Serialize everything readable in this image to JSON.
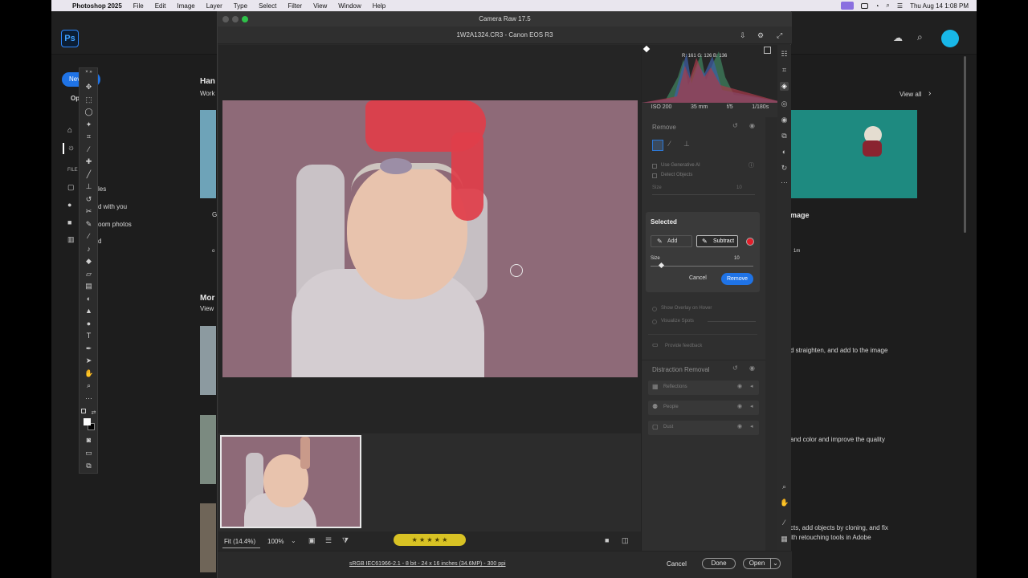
{
  "menubar": {
    "app": "Photoshop 2025",
    "items": [
      "File",
      "Edit",
      "Image",
      "Layer",
      "Type",
      "Select",
      "Filter",
      "View",
      "Window",
      "Help"
    ],
    "clock": "Thu Aug 14  1:08 PM"
  },
  "ps_home": {
    "logo": "Ps",
    "new_btn": "Nev",
    "open_label": "Op",
    "section1_title": "Han",
    "section1_sub": "Work",
    "section2_title": "Mor",
    "section2_sub": "View",
    "files_label": "FILE",
    "nav_partial": [
      "les",
      "d with you",
      "oom photos",
      "d"
    ],
    "view_all": "View all",
    "card_left_letter": "G",
    "card_left_small": "o",
    "card_title": "mage",
    "card_small": "1m",
    "desc1": "d straighten, and add to the image",
    "desc2": "and color and improve the quality",
    "desc3": "cts, add objects by cloning, and fix",
    "desc4": "ith retouching tools in Adobe"
  },
  "camera_raw": {
    "title": "Camera Raw 17.5",
    "file": "1W2A1324.CR3  -  Canon EOS R3",
    "histogram": {
      "r": "R: 161",
      "g": "G: 126",
      "b": "B: 136"
    },
    "exif": [
      "ISO 200",
      "35 mm",
      "f/5",
      "1/180s"
    ],
    "remove_panel": {
      "title": "Remove",
      "use_generative_ai": "Use Generative AI",
      "detect_objects": "Detect Objects",
      "size_label": "Size",
      "size_value": "10"
    },
    "selected_panel": {
      "title": "Selected",
      "add": "Add",
      "subtract": "Subtract",
      "size_label": "Size",
      "size_value": "10",
      "cancel": "Cancel",
      "remove": "Remove",
      "size_fraction": 0.1
    },
    "options": {
      "show_overlay": "Show Overlay on Hover",
      "visualize_spots": "Visualize Spots",
      "feedback": "Provide feedback"
    },
    "distraction": {
      "title": "Distraction Removal",
      "items": [
        "Reflections",
        "People",
        "Dust"
      ]
    },
    "bottom": {
      "fit": "Fit (14.4%)",
      "zoom": "100%",
      "stars": "★ ★ ★ ★ ★"
    },
    "footer": {
      "info": "sRGB IEC61966-2.1 - 8 bit - 24 x 16 inches (34.6MP) - 300 ppi",
      "cancel": "Cancel",
      "done": "Done",
      "open": "Open"
    }
  },
  "colors": {
    "accent": "#1f73e6",
    "mask_red": "#e03e4a",
    "backdrop": "#8e6a78"
  }
}
